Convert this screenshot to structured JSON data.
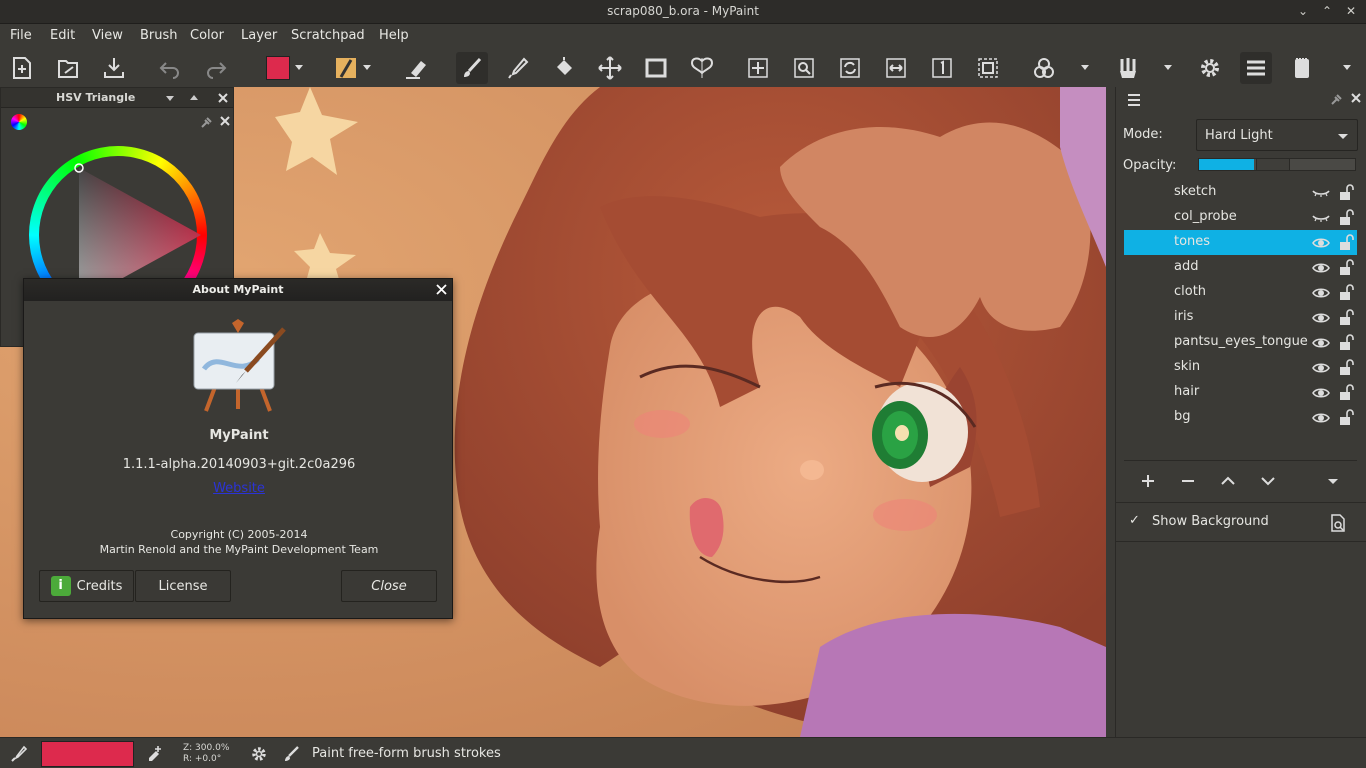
{
  "window": {
    "title": "scrap080_b.ora - MyPaint"
  },
  "menu": {
    "items": [
      "File",
      "Edit",
      "View",
      "Brush",
      "Color",
      "Layer",
      "Scratchpad",
      "Help"
    ]
  },
  "toolbar": {
    "color_swatch": "#dd2a4d"
  },
  "hsv_panel": {
    "title": "HSV Triangle"
  },
  "layers_panel": {
    "mode_label": "Mode:",
    "mode_value": "Hard Light",
    "opacity_label": "Opacity:",
    "opacity_value": 0.35,
    "layers": [
      {
        "name": "sketch",
        "visible": false,
        "selected": false
      },
      {
        "name": "col_probe",
        "visible": false,
        "selected": false
      },
      {
        "name": "tones",
        "visible": true,
        "selected": true
      },
      {
        "name": "add",
        "visible": true,
        "selected": false
      },
      {
        "name": "cloth",
        "visible": true,
        "selected": false
      },
      {
        "name": "iris",
        "visible": true,
        "selected": false
      },
      {
        "name": "pantsu_eyes_tongue",
        "visible": true,
        "selected": false
      },
      {
        "name": "skin",
        "visible": true,
        "selected": false
      },
      {
        "name": "hair",
        "visible": true,
        "selected": false
      },
      {
        "name": "bg",
        "visible": true,
        "selected": false
      }
    ],
    "show_background_label": "Show Background",
    "show_background_checked": true
  },
  "about": {
    "title": "About MyPaint",
    "app_name": "MyPaint",
    "version": "1.1.1-alpha.20140903+git.2c0a296",
    "website_label": "Website",
    "copyright": "Copyright (C) 2005-2014",
    "authors": "Martin Renold and the MyPaint Development Team",
    "credits_label": "Credits",
    "license_label": "License",
    "close_label": "Close"
  },
  "status": {
    "zoom": "Z: 300.0%",
    "rotation": "R: +0.0°",
    "message": "Paint free-form brush strokes",
    "brush_color": "#dd2a4d"
  },
  "colors": {
    "accent": "#0fb1e4",
    "panel": "#3b3a36"
  }
}
